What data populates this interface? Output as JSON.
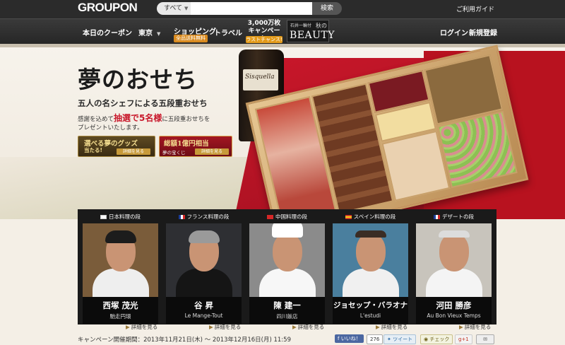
{
  "header": {
    "logo": "GROUPON",
    "search_scope": "すべて",
    "search_value": "",
    "search_button": "検索",
    "guide_link": "ご利用ガイド"
  },
  "nav": {
    "items": [
      "本日のクーポン",
      "東京",
      "ショッピング",
      "トラベル"
    ],
    "shopping_sub": "全品送料無料",
    "campaign_line1": "3,000万枚",
    "campaign_line2": "キャンペーン",
    "campaign_sub": "ラストチャンス!",
    "beauty_pre": "石井一輪付",
    "beauty_aki": "秋の",
    "beauty_word": "BEAUTY",
    "login": "ログイン",
    "signup": "新規登録"
  },
  "hero": {
    "title": "夢のおせち",
    "subtitle": "五人の名シェフによる五段重おせち",
    "desc_pre": "感謝を込めて",
    "desc_highlight": "抽選で5名様",
    "desc_post": "に五段重おせちを",
    "desc_line2": "プレゼントいたします。",
    "bottle_label": "Sisquella",
    "promo1_title": "選べる夢のグッズ",
    "promo1_title2": "当たる!",
    "promo1_button": "詳細を見る",
    "promo2_title": "総額1億円相当",
    "promo2_sub": "夢の宝くじ",
    "promo2_button": "詳細を見る"
  },
  "dishes": [
    {
      "header": "日本料理の段",
      "name": "西塚 茂光",
      "restaurant": "馳走円環",
      "link": "詳細を見る"
    },
    {
      "header": "フランス料理の段",
      "name": "谷 昇",
      "restaurant": "Le Mange-Tout",
      "link": "詳細を見る"
    },
    {
      "header": "中国料理の段",
      "name": "陳 建一",
      "restaurant": "四川飯店",
      "link": "詳細を見る"
    },
    {
      "header": "スペイン料理の段",
      "name": "ジョセップ・バラオナ",
      "restaurant": "L'estudi",
      "link": "詳細を見る"
    },
    {
      "header": "デザートの段",
      "name": "河田 勝彦",
      "restaurant": "Au Bon Vieux Temps",
      "link": "詳細を見る"
    }
  ],
  "footer": {
    "period": "キャンペーン開催期間：2013年11月21日(木) 〜 2013年12月16日(月) 11:59",
    "like_label": "いいね！",
    "like_count": "276",
    "tweet_label": "ツイート",
    "mixi_label": "チェック",
    "gplus_label": "g+1",
    "mail_icon": "✉"
  },
  "colors": {
    "accent_red": "#c8172a",
    "gold": "#c79a3a",
    "navbar": "#2b2b2b"
  }
}
